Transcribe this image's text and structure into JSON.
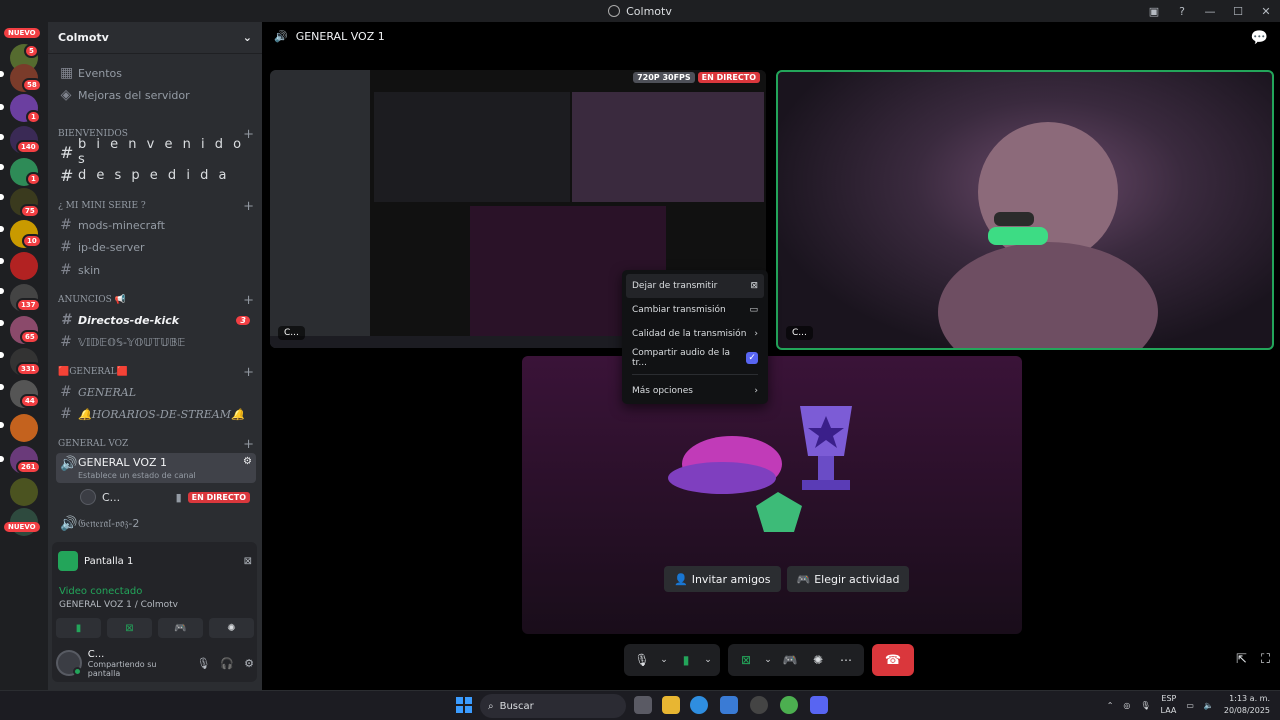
{
  "window": {
    "title": "Colmotv"
  },
  "rail": {
    "badges": [
      "5",
      "58",
      "1",
      "140",
      "1",
      "75",
      "10",
      "137",
      "65",
      "331",
      "44",
      "261"
    ],
    "nuevo_top": "NUEVO",
    "nuevo_bottom": "NUEVO"
  },
  "server": {
    "name": "Colmotv",
    "menu": {
      "events": "Eventos",
      "boosts": "Mejoras del servidor"
    }
  },
  "categories": {
    "bienvenidos": "BIENVENIDOS",
    "mini_serie": "¿ MI MINI SERIE ?",
    "anuncios": "ANUNCIOS 📢",
    "general": "🟥GENERAL🟥",
    "general_voz": "GENERAL VOZ"
  },
  "channels": {
    "bienvenidos": "b i e n v e n i d o s",
    "despedida": "d e s p e d i d a",
    "mods": "mods-minecraft",
    "ip": "ip-de-server",
    "skin": "skin",
    "directos": "Directos-de-kick",
    "directos_count": "3",
    "videos": "𝕍𝕀𝔻𝔼𝕆𝕊-𝕐𝕆𝕌𝕋𝕌𝔹𝔼",
    "general": "GENERAL",
    "horarios": "🔔HORARIOS-DE-STREAM🔔",
    "voz1": "GENERAL VOZ 1",
    "voz1_status": "Establece un estado de canal",
    "voz1_user": "C...",
    "live": "EN DIRECTO",
    "voz2": "𝔊𝔢𝔫𝔢𝔯𝔞𝔩-𝔳𝔬𝔷-2"
  },
  "voice_panel": {
    "screen_name": "Pantalla 1",
    "status": "Video conectado",
    "location": "GENERAL VOZ 1 / Colmotv",
    "user_name": "C...",
    "user_status": "Compartiendo su pantalla"
  },
  "main": {
    "channel_title": "GENERAL VOZ 1",
    "screen_tile": {
      "resolution": "720P 30FPS",
      "live": "EN DIRECTO",
      "label": "C..."
    },
    "cam_tile": {
      "label": "C..."
    },
    "activity": {
      "invite": "Invitar amigos",
      "choose": "Elegir actividad"
    }
  },
  "context_menu": {
    "items": [
      "Dejar de transmitir",
      "Cambiar transmisión",
      "Calidad de la transmisión",
      "Compartir audio de la tr...",
      "Más opciones"
    ]
  },
  "taskbar": {
    "search": "Buscar",
    "lang1": "ESP",
    "lang2": "LAA",
    "time": "1:13 a. m.",
    "date": "20/08/2025"
  },
  "colors": {
    "accent": "#5865f2",
    "green": "#23a55a",
    "red": "#da373c",
    "sidebar": "#2b2d31",
    "rail": "#1e1f22"
  }
}
